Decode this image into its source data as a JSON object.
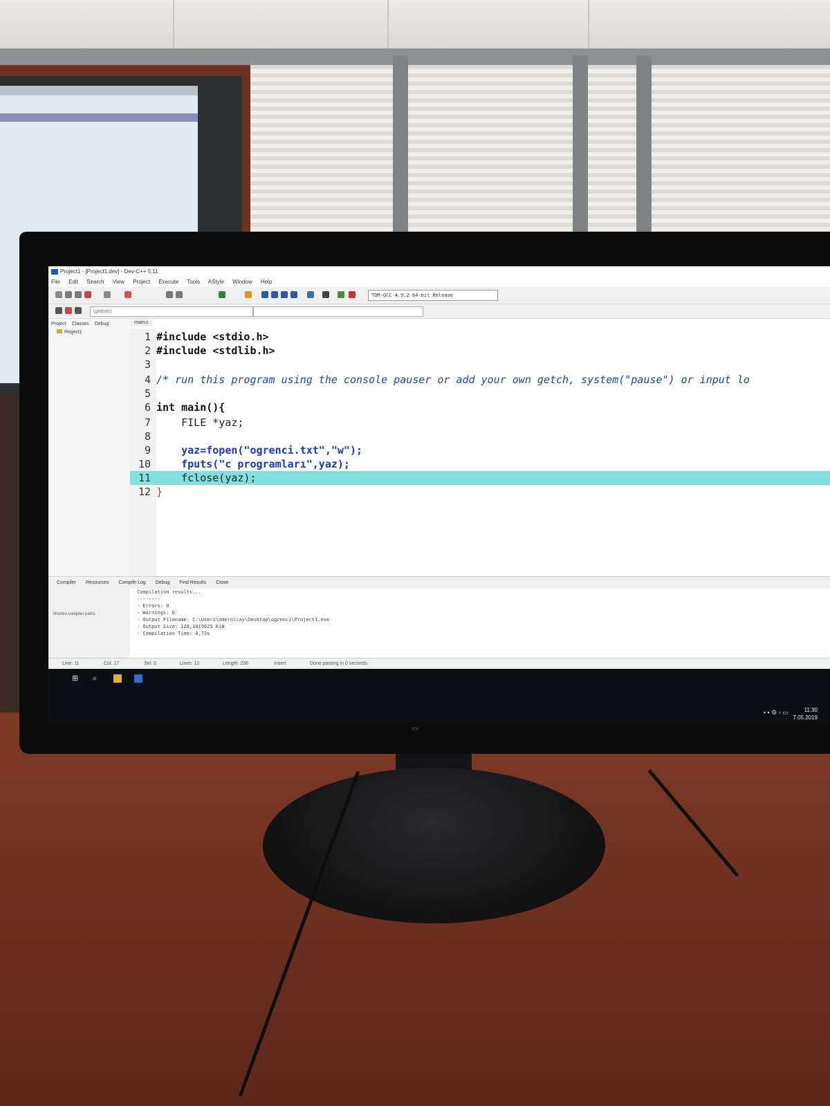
{
  "window": {
    "title": "Project1 - [Project1.dev] - Dev-C++ 5.11"
  },
  "menu": [
    "File",
    "Edit",
    "Search",
    "View",
    "Project",
    "Execute",
    "Tools",
    "AStyle",
    "Window",
    "Help"
  ],
  "toolbar": {
    "compiler": "TDM-GCC 4.9.2 64-bit Release",
    "globals_select": "(globals)"
  },
  "left_panel": {
    "tabs": [
      "Project",
      "Classes",
      "Debug"
    ],
    "tree_root": "Project1"
  },
  "editor": {
    "file_tab": "main.c",
    "lines": [
      {
        "n": "1",
        "text": "#include <stdio.h>"
      },
      {
        "n": "2",
        "text": "#include <stdlib.h>"
      },
      {
        "n": "3",
        "text": ""
      },
      {
        "n": "4",
        "text": "/* run this program using the console pauser or add your own getch, system(\"pause\") or input lo"
      },
      {
        "n": "5",
        "text": ""
      },
      {
        "n": "6",
        "text": "int main(){"
      },
      {
        "n": "7",
        "text": "    FILE *yaz;"
      },
      {
        "n": "8",
        "text": ""
      },
      {
        "n": "9",
        "text": "    yaz=fopen(\"ogrenci.txt\",\"w\");"
      },
      {
        "n": "10",
        "text": "    fputs(\"c programları\",yaz);"
      },
      {
        "n": "11",
        "text": "    fclose(yaz);"
      },
      {
        "n": "12",
        "text": "}"
      }
    ]
  },
  "bottom_tabs": [
    "Compiler",
    "Resources",
    "Compile Log",
    "Debug",
    "Find Results",
    "Close"
  ],
  "output": {
    "left_label": "Shorten compiler paths",
    "lines": [
      "Compilation results...",
      "--------",
      "- Errors: 0",
      "- Warnings: 0",
      "- Output Filename: C:\\Users\\omerolcay\\Desktop\\ogrenci\\Project1.exe",
      "- Output Size: 128,1015625 KiB",
      "- Compilation Time: 0,72s"
    ]
  },
  "statusbar": {
    "line": "Line: 11",
    "col": "Col: 17",
    "sel": "Sel: 0",
    "lines": "Lines: 12",
    "length": "Length: 256",
    "mode": "Insert",
    "message": "Done parsing in 0 seconds"
  },
  "taskbar": {
    "time": "11:30",
    "date": "7.05.2019"
  },
  "colors": {
    "highlight_line": "#7fe0de",
    "string": "#1538c8",
    "comment": "#1a44b8"
  }
}
